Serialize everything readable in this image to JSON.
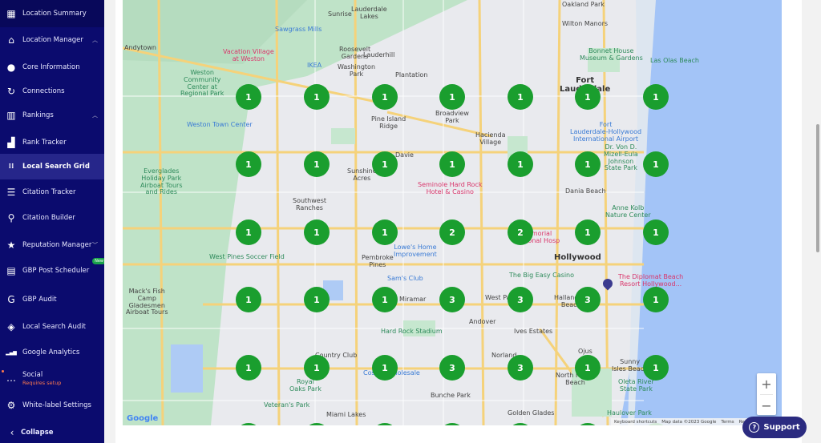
{
  "sidebar": {
    "items": [
      {
        "label": "Location Summary",
        "icon": "grid-icon"
      },
      {
        "label": "Location Manager",
        "icon": "home-icon",
        "expanded": true
      },
      {
        "label": "Core Information",
        "icon": "info-pin-icon"
      },
      {
        "label": "Connections",
        "icon": "connections-icon"
      },
      {
        "label": "Rankings",
        "icon": "rankings-icon",
        "expanded": true
      },
      {
        "label": "Rank Tracker",
        "icon": "rank-tracker-icon"
      },
      {
        "label": "Local Search Grid",
        "icon": "dots-grid-icon",
        "active": true
      },
      {
        "label": "Citation Tracker",
        "icon": "citation-tracker-icon"
      },
      {
        "label": "Citation Builder",
        "icon": "citation-builder-icon"
      },
      {
        "label": "Reputation Manager",
        "icon": "star-review-icon",
        "expanded": false
      },
      {
        "label": "GBP Post Scheduler",
        "icon": "post-scheduler-icon",
        "badge": "New"
      },
      {
        "label": "GBP Audit",
        "icon": "google-g-icon"
      },
      {
        "label": "Local Search Audit",
        "icon": "search-audit-icon"
      },
      {
        "label": "Google Analytics",
        "icon": "analytics-icon"
      },
      {
        "label": "Social",
        "icon": "chat-icon",
        "sublabel": "Requires setup"
      },
      {
        "label": "White-label Settings",
        "icon": "gear-icon"
      }
    ],
    "collapse_label": "Collapse"
  },
  "map": {
    "grid_values": [
      [
        1,
        1,
        1,
        1,
        1,
        1,
        1
      ],
      [
        1,
        1,
        1,
        1,
        1,
        1,
        1
      ],
      [
        1,
        1,
        1,
        2,
        2,
        1,
        1
      ],
      [
        1,
        1,
        1,
        3,
        3,
        3,
        1
      ],
      [
        1,
        1,
        1,
        3,
        3,
        1,
        1
      ]
    ],
    "marker_color": "#1a9e2e",
    "places": [
      {
        "name": "Andytown",
        "style": ""
      },
      {
        "name": "Vacation Village\nat Weston",
        "style": "pink"
      },
      {
        "name": "Sawgrass Mills",
        "style": "blue"
      },
      {
        "name": "Weston\nCommunity\nCenter at\nRegional Park",
        "style": "green"
      },
      {
        "name": "IKEA",
        "style": "blue"
      },
      {
        "name": "Weston Town Center",
        "style": "blue"
      },
      {
        "name": "Everglades\nHoliday Park\nAirboat Tours\nand Rides",
        "style": "green"
      },
      {
        "name": "Southwest\nRanches",
        "style": ""
      },
      {
        "name": "West Pines Soccer Field",
        "style": "green"
      },
      {
        "name": "Sunrise",
        "style": ""
      },
      {
        "name": "Lauderdale\nLakes",
        "style": ""
      },
      {
        "name": "Oakland Park",
        "style": ""
      },
      {
        "name": "Wilton Manors",
        "style": ""
      },
      {
        "name": "Lauderhill",
        "style": ""
      },
      {
        "name": "Roosevelt\nGardens",
        "style": ""
      },
      {
        "name": "Washington\nPark",
        "style": ""
      },
      {
        "name": "Plantation",
        "style": ""
      },
      {
        "name": "Broadview\nPark",
        "style": ""
      },
      {
        "name": "Pine Island\nRidge",
        "style": ""
      },
      {
        "name": "Bonnet House\nMuseum & Gardens",
        "style": "green"
      },
      {
        "name": "Fort\nLauderdale",
        "style": "bold"
      },
      {
        "name": "Las Olas Beach",
        "style": "green"
      },
      {
        "name": "Fort\nLauderdale-Hollywood\nInternational Airport",
        "style": "blue"
      },
      {
        "name": "Dr. Von D.\nMizell-Eula\nJohnson\nState Park",
        "style": "green"
      },
      {
        "name": "Davie",
        "style": ""
      },
      {
        "name": "Hacienda\nVillage",
        "style": ""
      },
      {
        "name": "Sunshine\nAcres",
        "style": ""
      },
      {
        "name": "Seminole Hard Rock\nHotel & Casino",
        "style": "pink"
      },
      {
        "name": "Dania Beach",
        "style": ""
      },
      {
        "name": "Anne Kolb\nNature Center",
        "style": "green"
      },
      {
        "name": "Pembroke\nPines",
        "style": ""
      },
      {
        "name": "Lowe's Home\nImprovement",
        "style": "blue"
      },
      {
        "name": "Memorial\nRegional Hosp",
        "style": "pink"
      },
      {
        "name": "Hollywood",
        "style": "bold"
      },
      {
        "name": "Sam's Club",
        "style": "blue"
      },
      {
        "name": "The Big Easy Casino",
        "style": "green"
      },
      {
        "name": "The Diplomat Beach\nResort Hollywood...",
        "style": "pink"
      },
      {
        "name": "Miramar",
        "style": ""
      },
      {
        "name": "West Park",
        "style": ""
      },
      {
        "name": "Hallandale\nBeach",
        "style": ""
      },
      {
        "name": "Hard Rock Stadium",
        "style": "green"
      },
      {
        "name": "Andover",
        "style": ""
      },
      {
        "name": "Ives Estates",
        "style": ""
      },
      {
        "name": "Country Club",
        "style": ""
      },
      {
        "name": "Norland",
        "style": ""
      },
      {
        "name": "Ojus",
        "style": ""
      },
      {
        "name": "Sunny\nIsles Beach",
        "style": ""
      },
      {
        "name": "North Miami\nBeach",
        "style": ""
      },
      {
        "name": "Costco Wholesale",
        "style": "blue"
      },
      {
        "name": "Royal\nOaks Park",
        "style": "green"
      },
      {
        "name": "Oleta River\nState Park",
        "style": "green"
      },
      {
        "name": "Bunche Park",
        "style": ""
      },
      {
        "name": "Veteran's Park",
        "style": "green"
      },
      {
        "name": "Golden Glades",
        "style": ""
      },
      {
        "name": "Miami Lakes",
        "style": ""
      },
      {
        "name": "Haulover Park",
        "style": "green"
      },
      {
        "name": "Mack's Fish\nCamp\nGladesmen\nAirboat Tours",
        "style": ""
      }
    ],
    "zoom_in_label": "+",
    "zoom_out_label": "−",
    "attribution": [
      "Keyboard shortcuts",
      "Map data ©2023 Google",
      "Terms",
      "Report a map error"
    ],
    "google_logo": "Google"
  },
  "support": {
    "label": "Support",
    "icon": "question-circle-icon"
  }
}
